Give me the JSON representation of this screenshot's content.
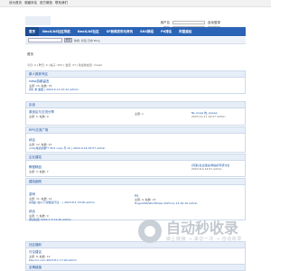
{
  "topbar": {
    "links": [
      "设为首页",
      "收藏本站",
      "官方微信",
      "联系我们"
    ]
  },
  "login": {
    "user_label": "用户名",
    "pass_label": "密码",
    "auto_login": "自动登录",
    "find_pw": "找回密码",
    "login_btn": "登录",
    "register": "立即注册"
  },
  "nav": {
    "items": [
      "首页",
      "NeoX/AE社区导航",
      "NeoX/AE社区",
      "SF新闻发布与资讯",
      "SNS群组",
      "PK排名",
      "阿里建站"
    ]
  },
  "subnav": {
    "search_btn": "搜索",
    "hot": "热搜: 标签 日志 Blog"
  },
  "crumb": "首页",
  "stats": "今日: 0 | 昨日: 0 | 帖子: 997 | 会员: 27 | 欢迎新会员: mopiz",
  "sections": [
    {
      "head": "新人报到专区",
      "forum": "neko游客留言",
      "meta": "主题: 15, 帖数: 76",
      "last": "[转] 求 星星 | 2024-5-12 10:12 admin"
    },
    {
      "head": "杂谈",
      "forum": "原创区与交流分享",
      "meta": "主题: 5, 帖数: 9",
      "right_meta": "主题: 1",
      "last": "NL-mopz 的_review",
      "last2": "2023-12-11 19:57 admin"
    },
    {
      "head": "RPG交流广场",
      "forum": "综合",
      "meta": "主题: 12, 帖数: 22",
      "last": "unity地表的那个 find coop 与 ob | 2024-4-16 15:57 admin"
    },
    {
      "head": "企业建站",
      "forum": "教程精品",
      "meta": "主题: 3, 帖数: 7",
      "right": "[问答]企业建站/网站的专项讨论",
      "right2": "2023-8-4 14:51 admin"
    },
    {
      "head": "建站细则",
      "forum": "游戏",
      "meta": "主题: 11, 帖数: 14",
      "last": "[好贴] 在以下功能运行过… | 2023-8-1 20:00 admin",
      "forum_b": "PS",
      "meta_b": "主题: 9, 帖数: 15",
      "last_b": "HugoCMS/WordPress 2023-11-15 10:19 admin",
      "forum2": "综合",
      "meta2": "主题: 7, 帖数: 9",
      "last2": "测试社区 2023-7-3 11:25 admin"
    },
    {
      "head": "社区福利",
      "forum": "讨论建议",
      "meta": "主题: 8, 帖数: 12",
      "last": "bbs.mo.com 2023-8-1 17:00 admin"
    }
  ],
  "last_section": "友情链接",
  "watermark": {
    "title": "自动秒收录",
    "subtitle": "做上链接 → 来访一次 → 自动收录"
  }
}
